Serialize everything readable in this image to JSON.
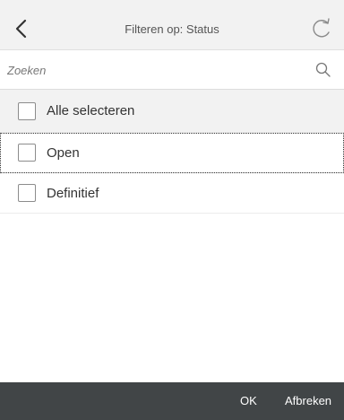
{
  "header": {
    "title": "Filteren op: Status",
    "back_icon": "chevron-left-icon",
    "refresh_icon": "refresh-icon"
  },
  "search": {
    "placeholder": "Zoeken",
    "value": "",
    "icon": "search-icon"
  },
  "select_all": {
    "label": "Alle selecteren",
    "checked": false
  },
  "items": [
    {
      "label": "Open",
      "checked": false,
      "focused": true
    },
    {
      "label": "Definitief",
      "checked": false,
      "focused": false
    }
  ],
  "footer": {
    "ok_label": "OK",
    "cancel_label": "Afbreken"
  },
  "colors": {
    "header_bg": "#f2f2f2",
    "footer_bg": "#414547",
    "text": "#333333",
    "checkbox_border": "#8c8c8c"
  }
}
